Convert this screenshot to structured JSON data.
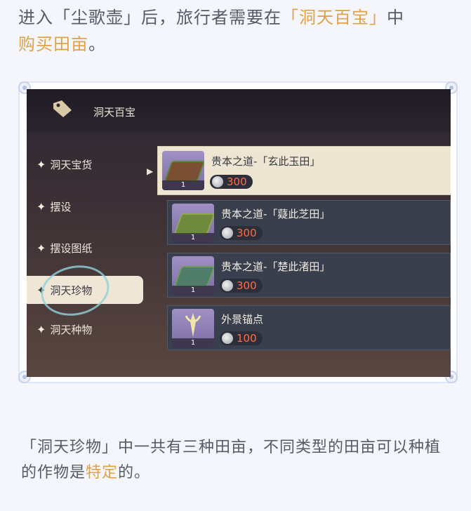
{
  "intro": {
    "part1": "进入「尘歌壶」后，旅行者需要在",
    "highlight1": "「洞天百宝」",
    "part2": "中",
    "highlight2": "购买田亩",
    "part3": "。"
  },
  "shop": {
    "title": "洞天百宝",
    "nav": [
      "洞天宝货",
      "摆设",
      "摆设图纸",
      "洞天珍物",
      "洞天种物"
    ],
    "active_nav_index": 3,
    "items": [
      {
        "name": "贵本之道-「玄此玉田」",
        "price": "300",
        "qty": "1"
      },
      {
        "name": "贵本之道-「薿此芝田」",
        "price": "300",
        "qty": "1"
      },
      {
        "name": "贵本之道-「楚此渚田」",
        "price": "300",
        "qty": "1"
      },
      {
        "name": "外景锚点",
        "price": "100",
        "qty": "1"
      }
    ]
  },
  "outro": {
    "part1": "「洞天珍物」中一共有三种田亩，不同类型的田亩可以种植的作物是",
    "highlight": "特定",
    "part2": "的。"
  },
  "colors": {
    "highlight": "#e0a247",
    "price": "#ff6c4a"
  }
}
